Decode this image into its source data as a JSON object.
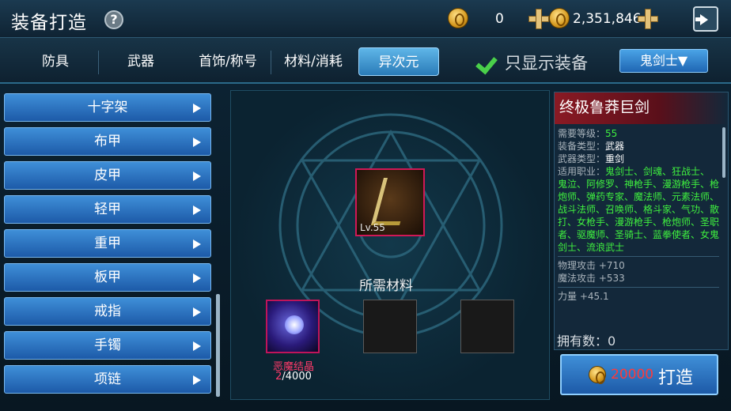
{
  "header": {
    "title": "装备打造",
    "help": "?",
    "currency1": "0",
    "currency2": "2,351,846"
  },
  "tabs": [
    {
      "label": "防具"
    },
    {
      "label": "武器"
    },
    {
      "label": "首饰/称号"
    },
    {
      "label": "材料/消耗"
    },
    {
      "label": "异次元"
    }
  ],
  "filter": {
    "label": "只显示装备",
    "class_select": "鬼剑士▼"
  },
  "categories": [
    "十字架",
    "布甲",
    "皮甲",
    "轻甲",
    "重甲",
    "板甲",
    "戒指",
    "手镯",
    "项链"
  ],
  "item": {
    "level": "Lv.55",
    "name": "终极鲁莽巨剑"
  },
  "materials": {
    "label": "所需材料",
    "name": "恶魔结晶",
    "have": "2",
    "need": "/4000"
  },
  "info": {
    "req_level_label": "需要等级：",
    "req_level": "55",
    "type_label": "装备类型：",
    "type": "武器",
    "wtype_label": "武器类型：",
    "wtype": "重剑",
    "job_label": "适用职业：",
    "jobs": "鬼剑士、剑魂、狂战士、鬼泣、阿修罗、神枪手、漫游枪手、枪炮师、弹药专家、魔法师、元素法师、战斗法师、召唤师、格斗家、气功、散打、女枪手、漫游枪手、枪炮师、圣职者、驱魔师、圣骑士、蓝拳使者、女鬼剑士、流浪武士",
    "patk": "物理攻击 +710",
    "matk": "魔法攻击 +533",
    "str": "力量 +45.1"
  },
  "owned": "拥有数：0",
  "craft": {
    "cost": "20000",
    "label": "打造"
  }
}
